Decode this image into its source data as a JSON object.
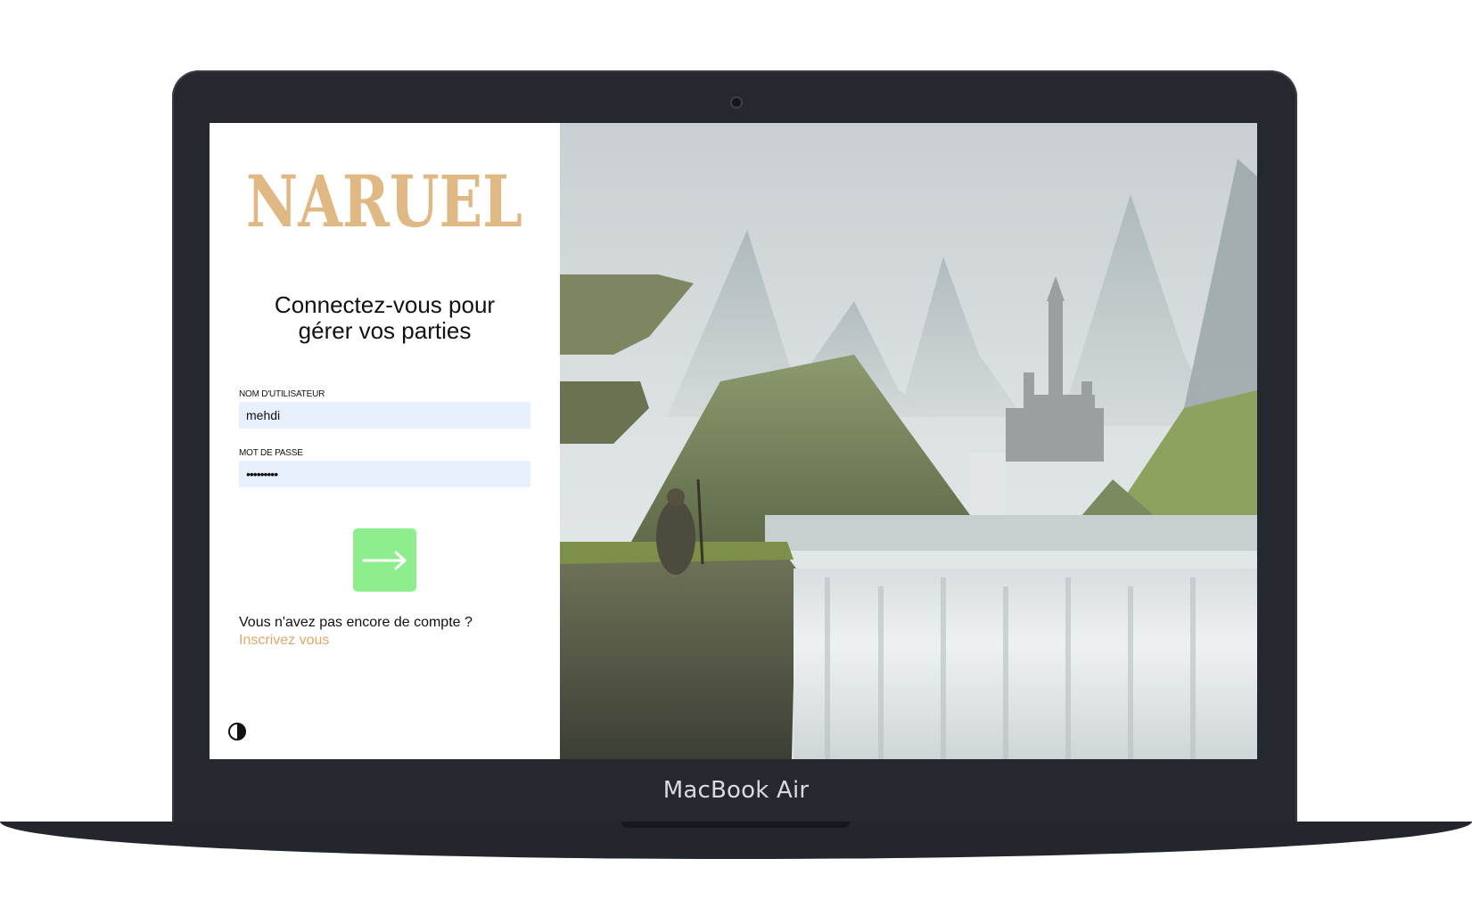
{
  "device": {
    "brand_label": "MacBook Air"
  },
  "app": {
    "logo_text": "NARUEL",
    "logo_color": "#e0b884",
    "heading_line1": "Connectez-vous pour",
    "heading_line2": "gérer vos parties"
  },
  "form": {
    "username_label": "NOM D'UTILISATEUR",
    "username_value": "mehdi",
    "password_label": "MOT DE PASSE",
    "password_value": "•••••••••",
    "submit_icon": "arrow-right-icon",
    "submit_color": "#8eee8e"
  },
  "signup": {
    "prompt": "Vous n'avez pas encore de compte ?",
    "link_label": "Inscrivez vous",
    "link_color": "#e4a66a"
  },
  "theme_toggle": {
    "icon": "contrast-icon"
  },
  "hero": {
    "description_icon": "fantasy-landscape-illustration"
  }
}
